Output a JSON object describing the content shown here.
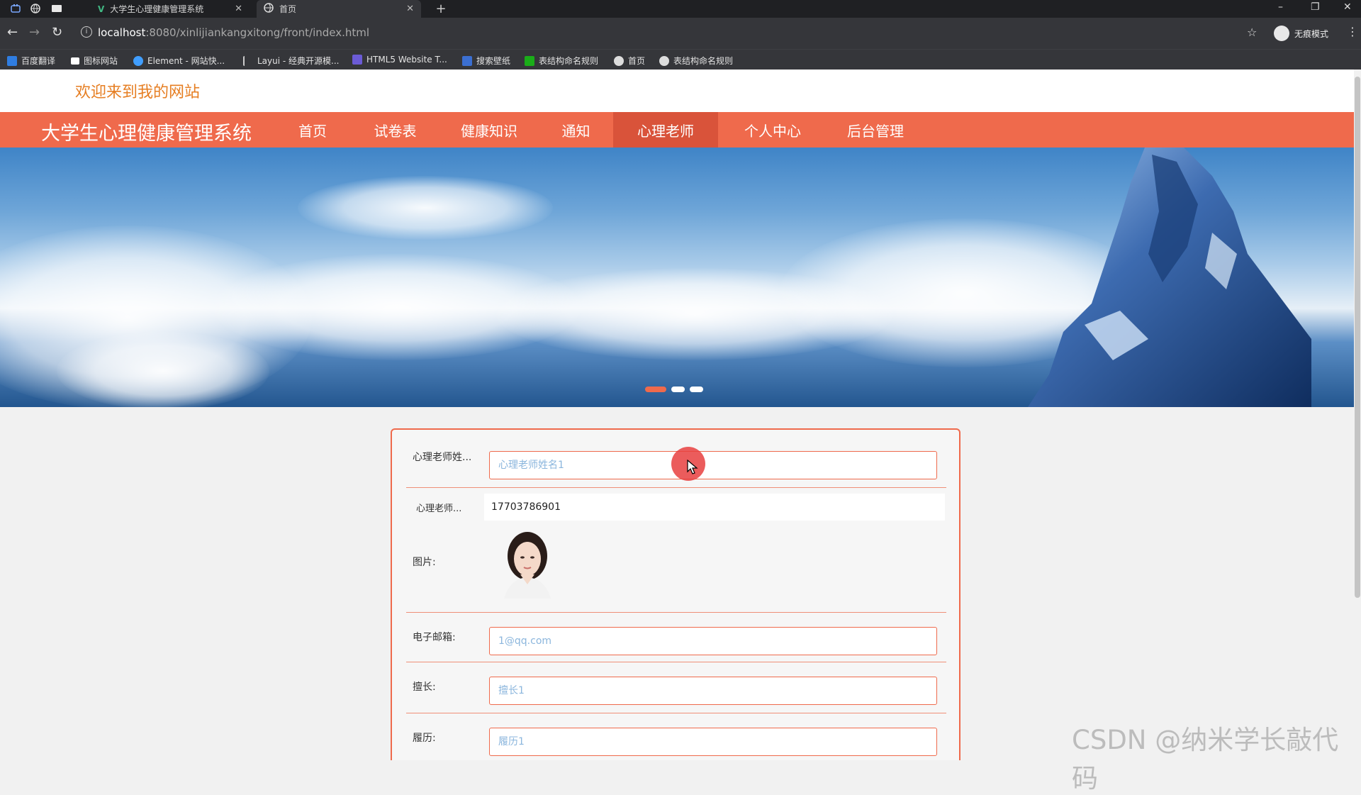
{
  "browser": {
    "tabs": [
      {
        "title": "大学生心理健康管理系统",
        "active": false
      },
      {
        "title": "首页",
        "active": true
      }
    ],
    "address": {
      "host": "localhost",
      "path": ":8080/xinlijiankangxitong/front/index.html"
    },
    "profile_label": "无痕模式",
    "bookmarks": [
      {
        "label": "百度翻译",
        "color": "#2f7de1"
      },
      {
        "label": "图标网站",
        "color": "#ffffff"
      },
      {
        "label": "Element - 网站快...",
        "color": "#409eff"
      },
      {
        "label": "Layui - 经典开源模...",
        "color": "#cccccc"
      },
      {
        "label": "HTML5 Website T...",
        "color": "#6b5bd6"
      },
      {
        "label": "搜索壁纸",
        "color": "#3b6fd1"
      },
      {
        "label": "表结构命名规则",
        "color": "#1aad19"
      },
      {
        "label": "首页",
        "color": "#dddddd"
      },
      {
        "label": "表结构命名规则",
        "color": "#dddddd"
      }
    ]
  },
  "site": {
    "welcome": "欢迎来到我的网站",
    "brand": "大学生心理健康管理系统",
    "nav": [
      {
        "label": "首页",
        "active": false
      },
      {
        "label": "试卷表",
        "active": false
      },
      {
        "label": "健康知识",
        "active": false
      },
      {
        "label": "通知",
        "active": false
      },
      {
        "label": "心理老师",
        "active": true
      },
      {
        "label": "个人中心",
        "active": false
      },
      {
        "label": "后台管理",
        "active": false
      }
    ],
    "carousel": {
      "slides": 3,
      "active_index": 0
    }
  },
  "form": {
    "name": {
      "label": "心理老师姓...",
      "placeholder": "心理老师姓名1"
    },
    "phone": {
      "label": "心理老师...",
      "value": "17703786901"
    },
    "image": {
      "label": "图片:"
    },
    "email": {
      "label": "电子邮箱:",
      "placeholder": "1@qq.com"
    },
    "specialty": {
      "label": "擅长:",
      "placeholder": "擅长1"
    },
    "resume": {
      "label": "履历:",
      "placeholder": "履历1"
    }
  },
  "watermark": "CSDN @纳米学长敲代码",
  "colors": {
    "accent": "#ef6a4c",
    "accent_dark": "#d9533a",
    "welcome": "#e67e22"
  }
}
